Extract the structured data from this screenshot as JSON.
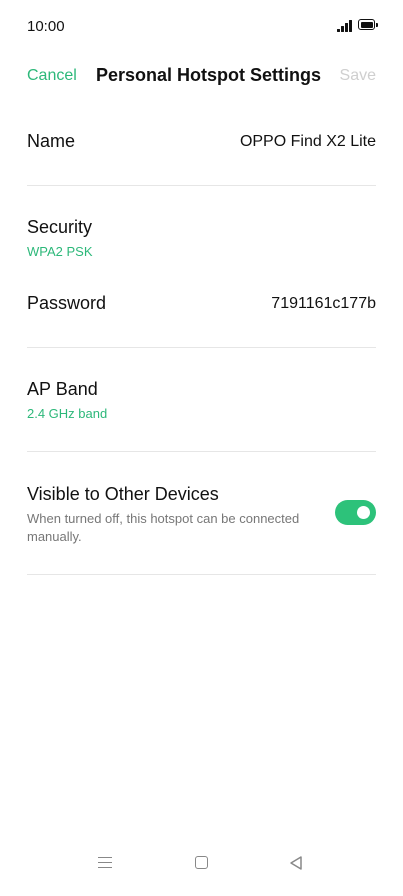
{
  "status_bar": {
    "time": "10:00",
    "icons": [
      "signal-icon",
      "battery-icon"
    ]
  },
  "header": {
    "cancel_label": "Cancel",
    "title": "Personal Hotspot Settings",
    "save_label": "Save"
  },
  "settings": {
    "name": {
      "label": "Name",
      "value": "OPPO Find X2 Lite"
    },
    "security": {
      "label": "Security",
      "value": "WPA2 PSK"
    },
    "password": {
      "label": "Password",
      "value": "7191161c177b"
    },
    "ap_band": {
      "label": "AP Band",
      "value": "2.4 GHz band"
    },
    "visible": {
      "label": "Visible to Other Devices",
      "description": "When turned off, this hotspot can be connected manually.",
      "enabled": true
    }
  },
  "colors": {
    "accent": "#2db87a",
    "toggle_on": "#2dc27a",
    "disabled_text": "#cfcfcf",
    "secondary_text": "#777777",
    "divider": "#e6e6e6"
  },
  "nav_bar": {
    "icons": [
      "menu-icon",
      "home-icon",
      "back-icon"
    ]
  }
}
